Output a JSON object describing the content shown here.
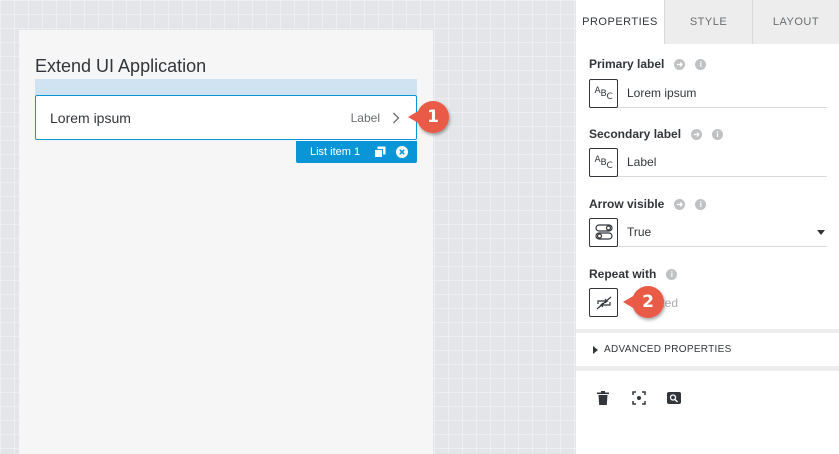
{
  "canvas": {
    "page_title": "Extend UI Application",
    "list_item": {
      "primary": "Lorem ipsum",
      "secondary": "Label"
    },
    "selection_tag": "List item 1"
  },
  "callouts": [
    "1",
    "2"
  ],
  "panel": {
    "tabs": [
      "PROPERTIES",
      "STYLE",
      "LAYOUT"
    ],
    "active_tab": "PROPERTIES",
    "fields": {
      "primary_label": {
        "label": "Primary label",
        "value": "Lorem ipsum"
      },
      "secondary_label": {
        "label": "Secondary label",
        "value": "Label"
      },
      "arrow_visible": {
        "label": "Arrow visible",
        "value": "True"
      },
      "repeat_with": {
        "label": "Repeat with",
        "value": "eated"
      }
    },
    "advanced": "ADVANCED PROPERTIES"
  },
  "colors": {
    "accent": "#0a96d6",
    "callout": "#ea5b47",
    "list_band": "#cfe3f3"
  },
  "icons": [
    "text-type-icon",
    "toggle-icon",
    "repeat-off-icon",
    "chevron-right-icon",
    "copy-icon",
    "close-circle-icon",
    "trash-icon",
    "focus-icon",
    "search-icon",
    "info-icon",
    "bind-arrow-icon",
    "caret-down-icon",
    "caret-right-icon"
  ]
}
